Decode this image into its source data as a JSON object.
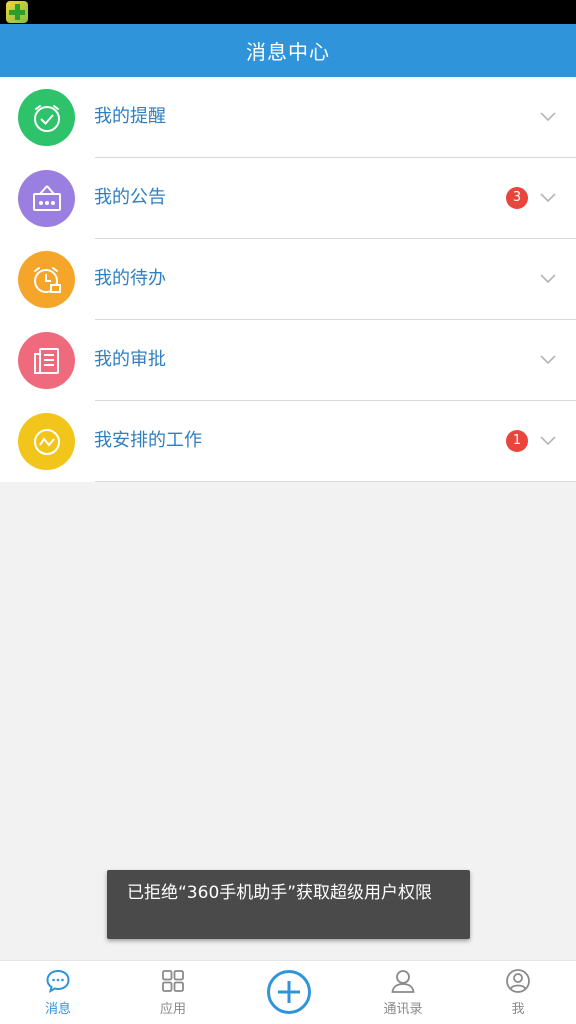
{
  "header": {
    "title": "消息中心"
  },
  "items": [
    {
      "label": "我的提醒",
      "badge": "",
      "color": "#2ec26b"
    },
    {
      "label": "我的公告",
      "badge": "3",
      "color": "#9a7fe0"
    },
    {
      "label": "我的待办",
      "badge": "",
      "color": "#f4a52a"
    },
    {
      "label": "我的审批",
      "badge": "",
      "color": "#f06a7e"
    },
    {
      "label": "我安排的工作",
      "badge": "1",
      "color": "#f2c51b"
    }
  ],
  "toast": {
    "text": "已拒绝“360手机助手”获取超级用户权限"
  },
  "tabs": [
    {
      "label": "消息"
    },
    {
      "label": "应用"
    },
    {
      "label": "通讯录"
    },
    {
      "label": "我"
    }
  ],
  "colors": {
    "accent": "#2f94d9",
    "badge": "#e8453c",
    "label": "#2f7fc1"
  }
}
